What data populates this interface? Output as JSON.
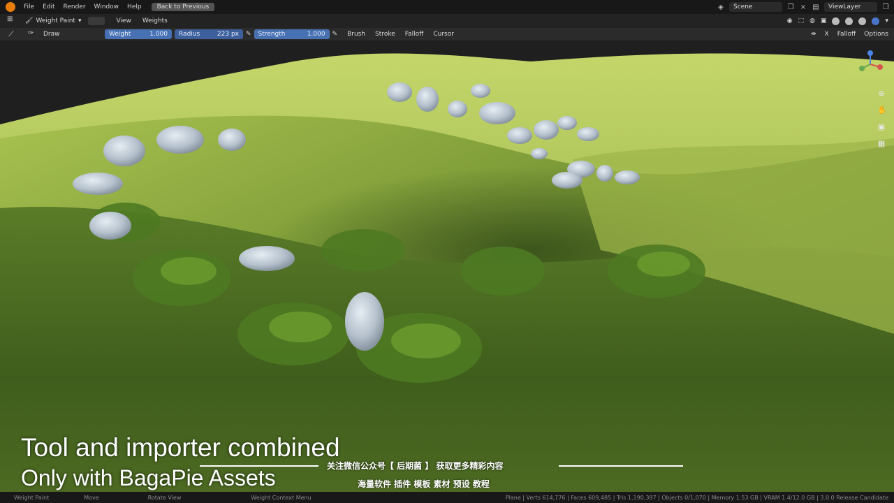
{
  "menu": {
    "items": [
      "File",
      "Edit",
      "Render",
      "Window",
      "Help"
    ],
    "back_button": "Back to Previous",
    "scene": "Scene",
    "view_layer": "ViewLayer"
  },
  "header": {
    "mode": "Weight Paint",
    "view": "View",
    "weights": "Weights"
  },
  "toolbar": {
    "tool": "Draw",
    "weight_label": "Weight",
    "weight_value": "1.000",
    "radius_label": "Radius",
    "radius_value": "223 px",
    "strength_label": "Strength",
    "strength_value": "1.000",
    "brush": "Brush",
    "stroke": "Stroke",
    "falloff": "Falloff",
    "cursor": "Cursor",
    "axis": "X",
    "falloff_right": "Falloff",
    "options": "Options"
  },
  "captions": {
    "line1": "Tool and importer combined",
    "line2": "Only with BagaPie Assets",
    "cn1": "关注微信公众号【 后期菌 】 获取更多精彩内容",
    "cn2": "海量软件 插件 模板 素材 预设 教程"
  },
  "status": {
    "left1": "Weight Paint",
    "left2": "Move",
    "left3": "Rotate View",
    "mid": "Weight Context Menu",
    "stats": "Plane | Verts 614,776 | Faces 609,485 | Tris 1,190,397 | Objects 0/1,070 | Memory 1.53 GB | VRAM 1.4/12.0 GB | 3.0.0 Release Candidate"
  },
  "colors": {
    "accent_slider": "#4771b3",
    "grass_light": "#b8cf5c",
    "grass_dark": "#2e4a1a",
    "blender_orange": "#e87d0d"
  }
}
